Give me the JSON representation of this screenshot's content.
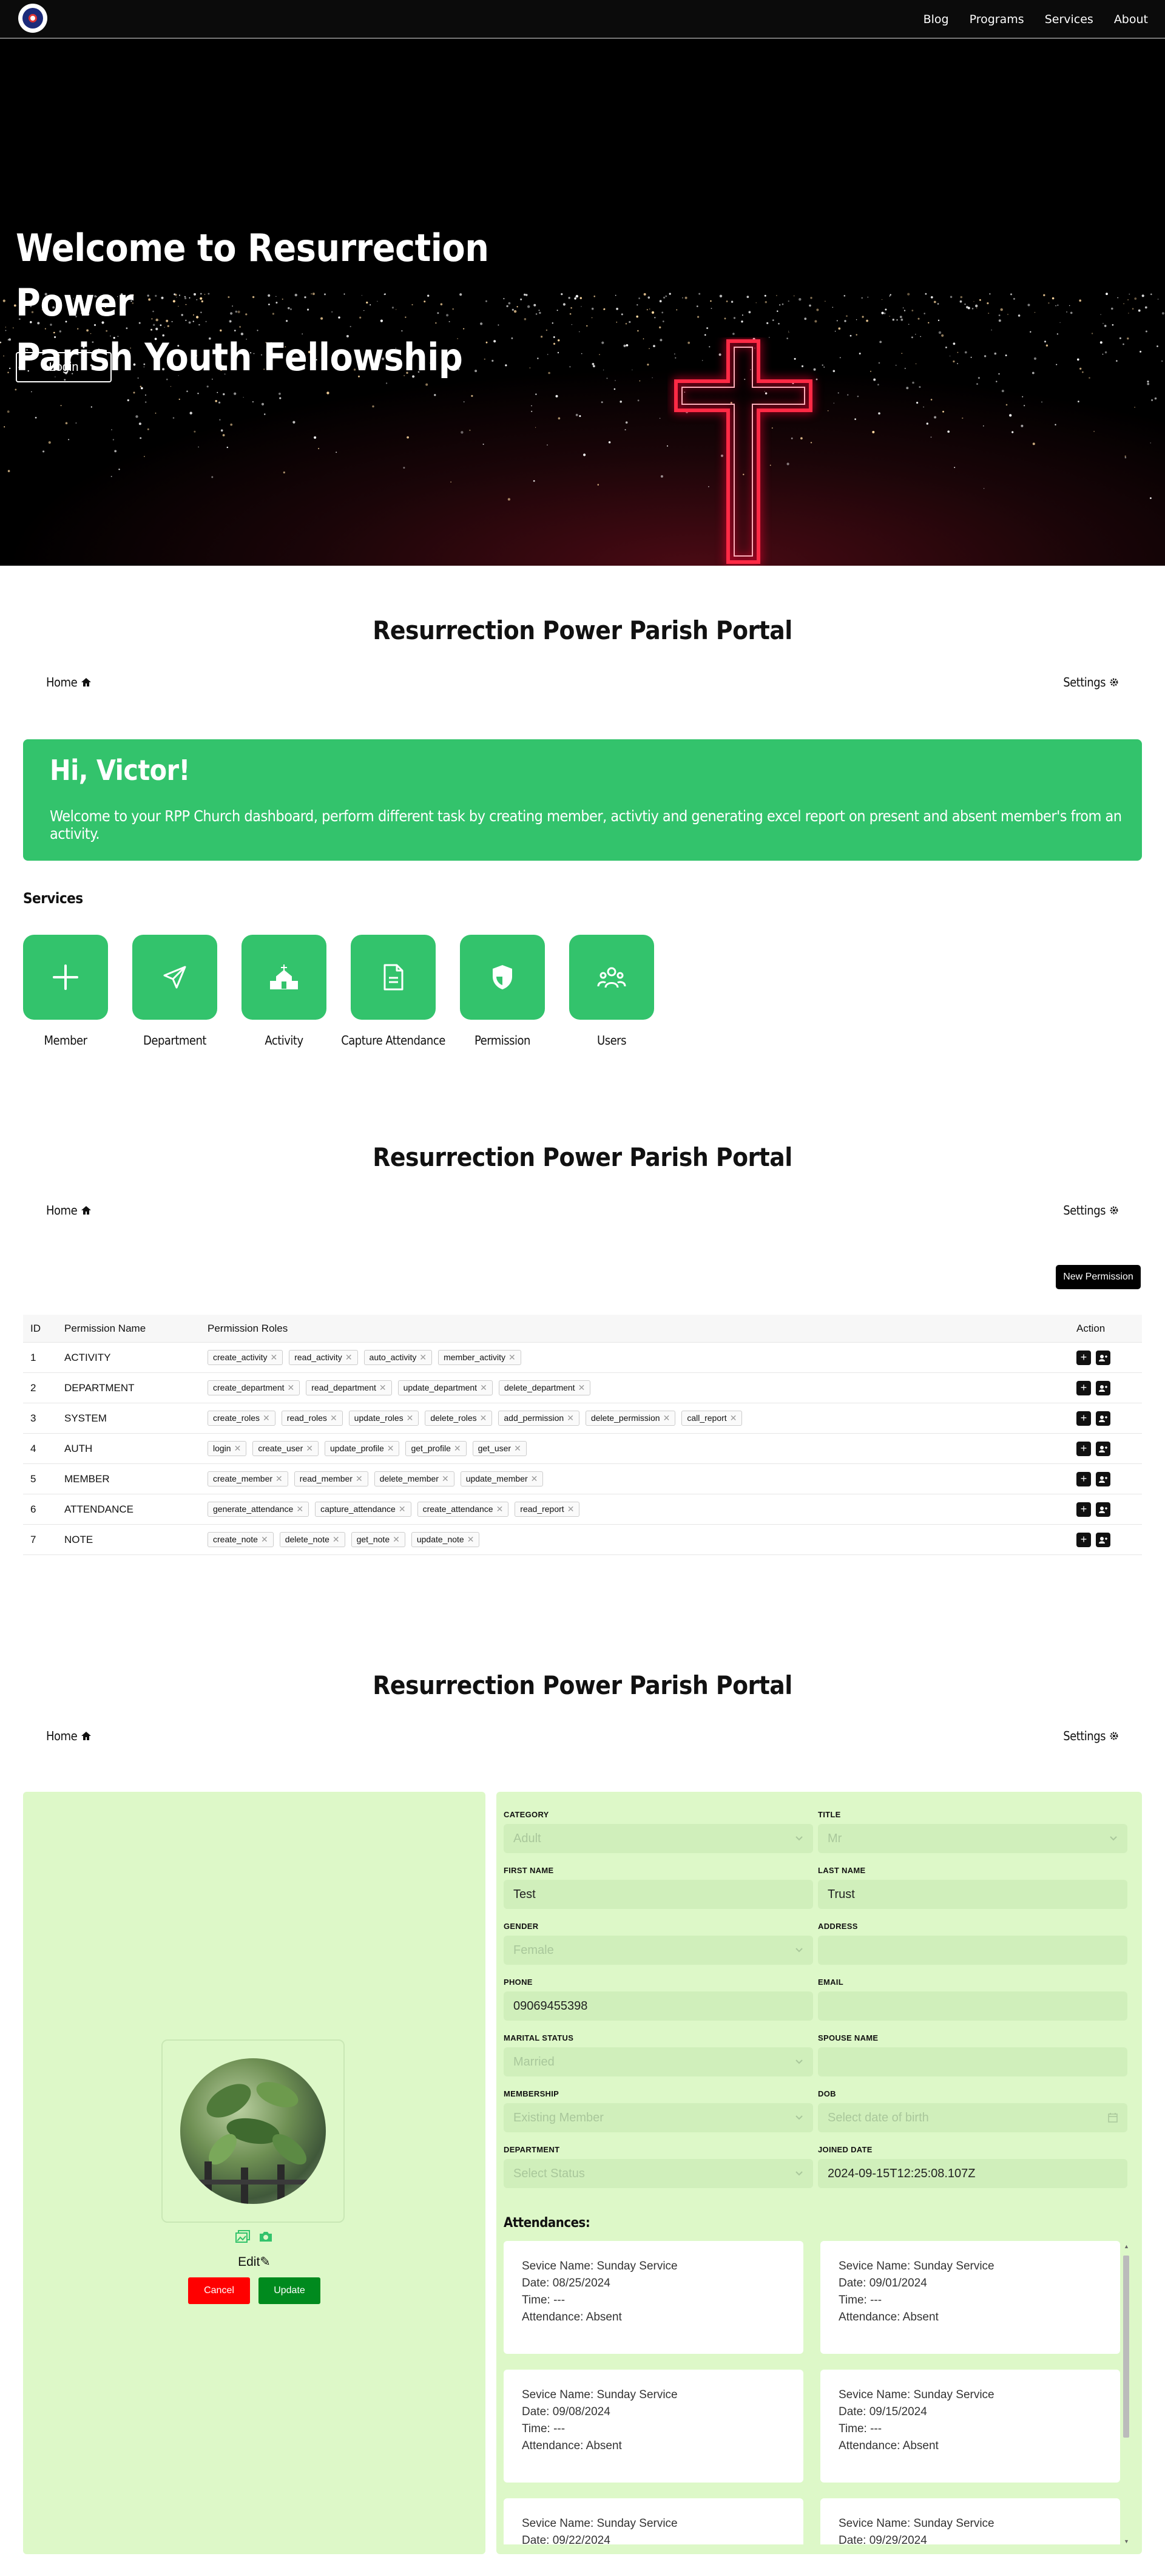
{
  "nav": {
    "links": [
      "Blog",
      "Programs",
      "Services",
      "About"
    ]
  },
  "hero": {
    "title_line1": "Welcome to Resurrection Power",
    "title_line2": "Parish Youth Fellowship",
    "login_label": "Login"
  },
  "portal": {
    "title": "Resurrection Power Parish Portal",
    "home_label": "Home",
    "settings_label": "Settings"
  },
  "dashboard": {
    "greeting": "Hi, Victor!",
    "welcome": "Welcome to your RPP Church dashboard, perform different task by creating member, activtiy and generating excel report on present and absent member's from an activity.",
    "services_label": "Services",
    "services": [
      {
        "label": "Member",
        "icon": "plus-icon"
      },
      {
        "label": "Department",
        "icon": "send-icon"
      },
      {
        "label": "Activity",
        "icon": "church-icon"
      },
      {
        "label": "Capture Attendance",
        "icon": "document-icon"
      },
      {
        "label": "Permission",
        "icon": "shield-icon"
      },
      {
        "label": "Users",
        "icon": "users-icon"
      }
    ]
  },
  "permissions": {
    "new_label": "New Permission",
    "headers": {
      "id": "ID",
      "name": "Permission Name",
      "roles": "Permission Roles",
      "action": "Action"
    },
    "rows": [
      {
        "id": "1",
        "name": "ACTIVITY",
        "roles": [
          "create_activity",
          "read_activity",
          "auto_activity",
          "member_activity"
        ]
      },
      {
        "id": "2",
        "name": "DEPARTMENT",
        "roles": [
          "create_department",
          "read_department",
          "update_department",
          "delete_department"
        ]
      },
      {
        "id": "3",
        "name": "SYSTEM",
        "roles": [
          "create_roles",
          "read_roles",
          "update_roles",
          "delete_roles",
          "add_permission",
          "delete_permission",
          "call_report"
        ]
      },
      {
        "id": "4",
        "name": "AUTH",
        "roles": [
          "login",
          "create_user",
          "update_profile",
          "get_profile",
          "get_user"
        ]
      },
      {
        "id": "5",
        "name": "MEMBER",
        "roles": [
          "create_member",
          "read_member",
          "delete_member",
          "update_member"
        ]
      },
      {
        "id": "6",
        "name": "ATTENDANCE",
        "roles": [
          "generate_attendance",
          "capture_attendance",
          "create_attendance",
          "read_report"
        ]
      },
      {
        "id": "7",
        "name": "NOTE",
        "roles": [
          "create_note",
          "delete_note",
          "get_note",
          "update_note"
        ]
      }
    ]
  },
  "member": {
    "edit_label": "Edit",
    "cancel_label": "Cancel",
    "update_label": "Update",
    "fields": {
      "category": {
        "label": "CATEGORY",
        "value": "Adult",
        "placeholder": true
      },
      "title": {
        "label": "TITLE",
        "value": "Mr",
        "placeholder": true
      },
      "first_name": {
        "label": "FIRST NAME",
        "value": "Test"
      },
      "last_name": {
        "label": "LAST NAME",
        "value": "Trust"
      },
      "gender": {
        "label": "GENDER",
        "value": "Female",
        "placeholder": true
      },
      "address": {
        "label": "ADDRESS",
        "value": ""
      },
      "phone": {
        "label": "PHONE",
        "value": "09069455398"
      },
      "email": {
        "label": "EMAIL",
        "value": ""
      },
      "marital_status": {
        "label": "MARITAL STATUS",
        "value": "Married",
        "placeholder": true
      },
      "spouse_name": {
        "label": "SPOUSE NAME",
        "value": ""
      },
      "membership": {
        "label": "MEMBERSHIP",
        "value": "Existing Member",
        "placeholder": true
      },
      "dob": {
        "label": "DOB",
        "value": "Select date of birth",
        "placeholder": true
      },
      "department": {
        "label": "DEPARTMENT",
        "value": "Select Status",
        "placeholder": true
      },
      "joined_date": {
        "label": "JOINED DATE",
        "value": "2024-09-15T12:25:08.107Z"
      }
    },
    "attendances_label": "Attendances:",
    "attendances": [
      {
        "service": "Sevice Name: Sunday Service",
        "date": "Date: 08/25/2024",
        "time": "Time: ---",
        "status": "Attendance: Absent"
      },
      {
        "service": "Sevice Name: Sunday Service",
        "date": "Date: 09/01/2024",
        "time": "Time: ---",
        "status": "Attendance: Absent"
      },
      {
        "service": "Sevice Name: Sunday Service",
        "date": "Date: 09/08/2024",
        "time": "Time: ---",
        "status": "Attendance: Absent"
      },
      {
        "service": "Sevice Name: Sunday Service",
        "date": "Date: 09/15/2024",
        "time": "Time: ---",
        "status": "Attendance: Absent"
      },
      {
        "service": "Sevice Name: Sunday Service",
        "date": "Date: 09/22/2024",
        "time": "",
        "status": ""
      },
      {
        "service": "Sevice Name: Sunday Service",
        "date": "Date: 09/29/2024",
        "time": "",
        "status": ""
      }
    ]
  }
}
